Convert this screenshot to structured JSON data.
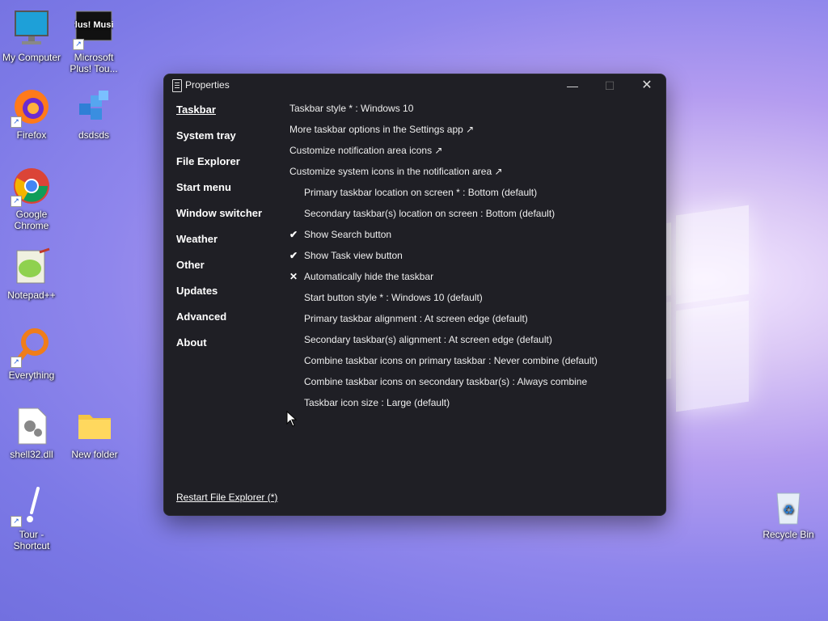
{
  "desktop": {
    "icons": [
      {
        "label": "My Computer",
        "icon": "monitor-icon"
      },
      {
        "label": "Microsoft Plus! Tou...",
        "icon": "plus-music-icon"
      },
      {
        "label": "Firefox",
        "icon": "firefox-icon"
      },
      {
        "label": "dsdsds",
        "icon": "registry-icon"
      },
      {
        "label": "Google Chrome",
        "icon": "chrome-icon"
      },
      {
        "label": "Notepad++",
        "icon": "notepadpp-icon"
      },
      {
        "label": "Everything",
        "icon": "search-magnifier-icon"
      },
      {
        "label": "shell32.dll",
        "icon": "dll-file-icon"
      },
      {
        "label": "New folder",
        "icon": "folder-icon"
      },
      {
        "label": "Tour - Shortcut",
        "icon": "tour-icon"
      },
      {
        "label": "Recycle Bin",
        "icon": "recycle-bin-icon"
      }
    ],
    "plus_icon_text": "Plus! Music"
  },
  "window": {
    "title": "Properties",
    "minimize": "—",
    "maximize": "☐",
    "close": "✕",
    "nav": [
      {
        "label": "Taskbar",
        "active": true
      },
      {
        "label": "System tray"
      },
      {
        "label": "File Explorer"
      },
      {
        "label": "Start menu"
      },
      {
        "label": "Window switcher"
      },
      {
        "label": "Weather"
      },
      {
        "label": "Other"
      },
      {
        "label": "Updates"
      },
      {
        "label": "Advanced"
      },
      {
        "label": "About"
      }
    ],
    "settings": [
      {
        "text": "Taskbar style * : Windows 10",
        "mark": ""
      },
      {
        "text": "More taskbar options in the Settings app ↗",
        "mark": ""
      },
      {
        "text": "Customize notification area icons ↗",
        "mark": ""
      },
      {
        "text": "Customize system icons in the notification area ↗",
        "mark": ""
      },
      {
        "text": "Primary taskbar location on screen * : Bottom (default)",
        "mark": ""
      },
      {
        "text": "Secondary taskbar(s) location on screen : Bottom (default)",
        "mark": ""
      },
      {
        "text": "Show Search button",
        "mark": "✔"
      },
      {
        "text": "Show Task view button",
        "mark": "✔"
      },
      {
        "text": "Automatically hide the taskbar",
        "mark": "✕"
      },
      {
        "text": "Start button style * : Windows 10 (default)",
        "mark": ""
      },
      {
        "text": "Primary taskbar alignment : At screen edge (default)",
        "mark": ""
      },
      {
        "text": "Secondary taskbar(s) alignment : At screen edge (default)",
        "mark": ""
      },
      {
        "text": "Combine taskbar icons on primary taskbar : Never combine (default)",
        "mark": ""
      },
      {
        "text": "Combine taskbar icons on secondary taskbar(s) : Always combine",
        "mark": ""
      },
      {
        "text": "Taskbar icon size : Large (default)",
        "mark": ""
      }
    ],
    "restart_label": "Restart File Explorer (*)"
  },
  "colors": {
    "window_bg": "#1f1f25",
    "text": "#ffffff"
  }
}
